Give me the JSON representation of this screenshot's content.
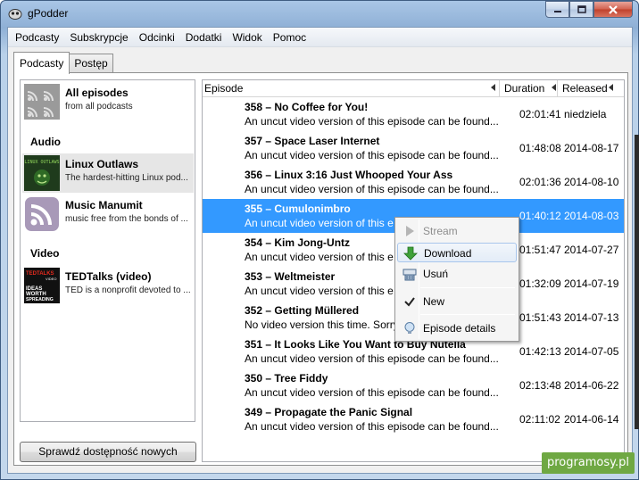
{
  "window": {
    "title": "gPodder"
  },
  "menu": [
    "Podcasty",
    "Subskrypcje",
    "Odcinki",
    "Dodatki",
    "Widok",
    "Pomoc"
  ],
  "tabs": [
    "Podcasty",
    "Postęp"
  ],
  "podcasts": {
    "all": {
      "title": "All episodes",
      "subtitle": "from all podcasts"
    },
    "audio_heading": "Audio",
    "audio": [
      {
        "title": "Linux Outlaws",
        "subtitle": "The hardest-hitting Linux pod..."
      },
      {
        "title": "Music Manumit",
        "subtitle": "music free from the bonds of ..."
      }
    ],
    "video_heading": "Video",
    "video": [
      {
        "title": "TEDTalks (video)",
        "subtitle": "TED is a nonprofit devoted to ..."
      }
    ],
    "thumb_text": {
      "linux": "LINUX OUTLAWS",
      "ted_line1": "TEDTALKS",
      "ted_line2": "VIDEO",
      "ted_line3": "IDEAS",
      "ted_line4": "WORTH",
      "ted_line5": "SPREADING"
    }
  },
  "check_button": "Sprawdź dostępność nowych",
  "episode_columns": {
    "episode": "Episode",
    "duration": "Duration",
    "released": "Released"
  },
  "episodes": [
    {
      "title": "358 – No Coffee for You!",
      "desc": "An uncut video version of this episode can be found...",
      "duration": "02:01:41",
      "released": "niedziela"
    },
    {
      "title": "357 – Space Laser Internet",
      "desc": "An uncut video version of this episode can be found...",
      "duration": "01:48:08",
      "released": "2014-08-17"
    },
    {
      "title": "356 – Linux 3:16 Just Whooped Your Ass",
      "desc": "An uncut video version of this episode can be found...",
      "duration": "02:01:36",
      "released": "2014-08-10"
    },
    {
      "title": "355 – Cumulonimbro",
      "desc": "An uncut video version of this e",
      "duration": "01:40:12",
      "released": "2014-08-03"
    },
    {
      "title": "354 – Kim Jong-Untz",
      "desc": "An uncut video version of this e",
      "duration": "01:51:47",
      "released": "2014-07-27"
    },
    {
      "title": "353 – Weltmeister",
      "desc": "An uncut video version of this e",
      "duration": "01:32:09",
      "released": "2014-07-19"
    },
    {
      "title": "352 – Getting Müllered",
      "desc": "No video version this time. Sorry",
      "duration": "01:51:43",
      "released": "2014-07-13"
    },
    {
      "title": "351 – It Looks Like You Want to Buy Nutella",
      "desc": "An uncut video version of this episode can be found...",
      "duration": "01:42:13",
      "released": "2014-07-05"
    },
    {
      "title": "350 – Tree Fiddy",
      "desc": "An uncut video version of this episode can be found...",
      "duration": "02:13:48",
      "released": "2014-06-22"
    },
    {
      "title": "349 – Propagate the Panic Signal",
      "desc": "An uncut video version of this episode can be found...",
      "duration": "02:11:02",
      "released": "2014-06-14"
    }
  ],
  "context_menu": {
    "stream": "Stream",
    "download": "Download",
    "remove": "Usuń",
    "new": "New",
    "details": "Episode details"
  },
  "watermark": "programosy.pl",
  "colors": {
    "selection": "#3399ff",
    "download_green": "#3fa13a"
  }
}
